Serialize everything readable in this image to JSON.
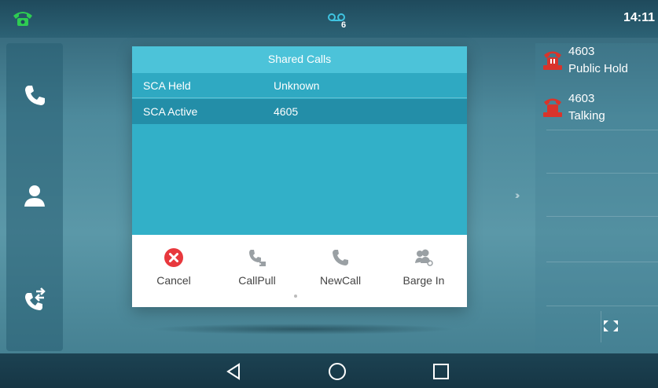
{
  "status_bar": {
    "time": "14:11",
    "voicemail_count": "6",
    "phone_icon": "handset-icon",
    "voicemail_icon": "voicemail-icon"
  },
  "left_dock": {
    "items": [
      {
        "icon": "phone-call-icon"
      },
      {
        "icon": "contact-icon"
      },
      {
        "icon": "call-history-icon"
      }
    ]
  },
  "dialog": {
    "title": "Shared Calls",
    "rows": [
      {
        "label": "SCA Held",
        "value": "Unknown"
      },
      {
        "label": "SCA Active",
        "value": "4605"
      }
    ],
    "softkeys": [
      {
        "label": "Cancel",
        "icon": "cancel-icon"
      },
      {
        "label": "CallPull",
        "icon": "callpull-icon"
      },
      {
        "label": "NewCall",
        "icon": "newcall-icon"
      },
      {
        "label": "Barge In",
        "icon": "barge-in-icon"
      }
    ]
  },
  "lines": [
    {
      "number": "4603",
      "status": "Public Hold",
      "icon": "shared-line-hold-icon"
    },
    {
      "number": "4603",
      "status": "Talking",
      "icon": "shared-line-talking-icon"
    }
  ],
  "nav": {
    "back": "back-icon",
    "home": "home-icon",
    "recent": "recent-apps-icon"
  },
  "colors": {
    "title_bar": "#4cc3d9",
    "dialog_body": "#32b0c8",
    "selected_row": "#238ea8",
    "cancel_red": "#e8383d",
    "line_red": "#d9342b",
    "phone_green": "#2ecc52"
  }
}
